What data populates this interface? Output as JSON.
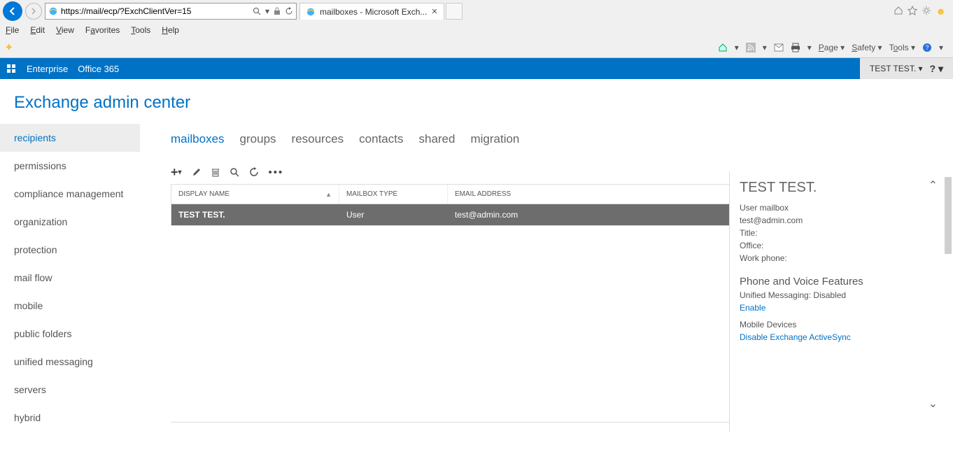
{
  "browser": {
    "url": "https://mail/ecp/?ExchClientVer=15",
    "tab_title": "mailboxes - Microsoft Exch...",
    "menus": {
      "file": "File",
      "edit": "Edit",
      "view": "View",
      "favorites": "Favorites",
      "tools": "Tools",
      "help": "Help"
    },
    "cmd": {
      "page": "Page",
      "safety": "Safety",
      "tools": "Tools"
    }
  },
  "header": {
    "brand_enterprise": "Enterprise",
    "brand_o365": "Office 365",
    "user": "TEST TEST.",
    "help_glyph": "?"
  },
  "eac_title": "Exchange admin center",
  "left_nav": [
    "recipients",
    "permissions",
    "compliance management",
    "organization",
    "protection",
    "mail flow",
    "mobile",
    "public folders",
    "unified messaging",
    "servers",
    "hybrid"
  ],
  "tabs": [
    "mailboxes",
    "groups",
    "resources",
    "contacts",
    "shared",
    "migration"
  ],
  "columns": {
    "name": "DISPLAY NAME",
    "type": "MAILBOX TYPE",
    "email": "EMAIL ADDRESS"
  },
  "rows": [
    {
      "name": "TEST TEST.",
      "type": "User",
      "email": "test@admin.com"
    }
  ],
  "details": {
    "title": "TEST TEST.",
    "mailbox_kind": "User mailbox",
    "email": "test@admin.com",
    "title_label": "Title:",
    "office_label": "Office:",
    "work_phone_label": "Work phone:",
    "section_phone": "Phone and Voice Features",
    "um_label": "Unified Messaging:",
    "um_value": "Disabled",
    "enable_link": "Enable",
    "mobile_label": "Mobile Devices",
    "disable_eas_link": "Disable Exchange ActiveSync"
  }
}
